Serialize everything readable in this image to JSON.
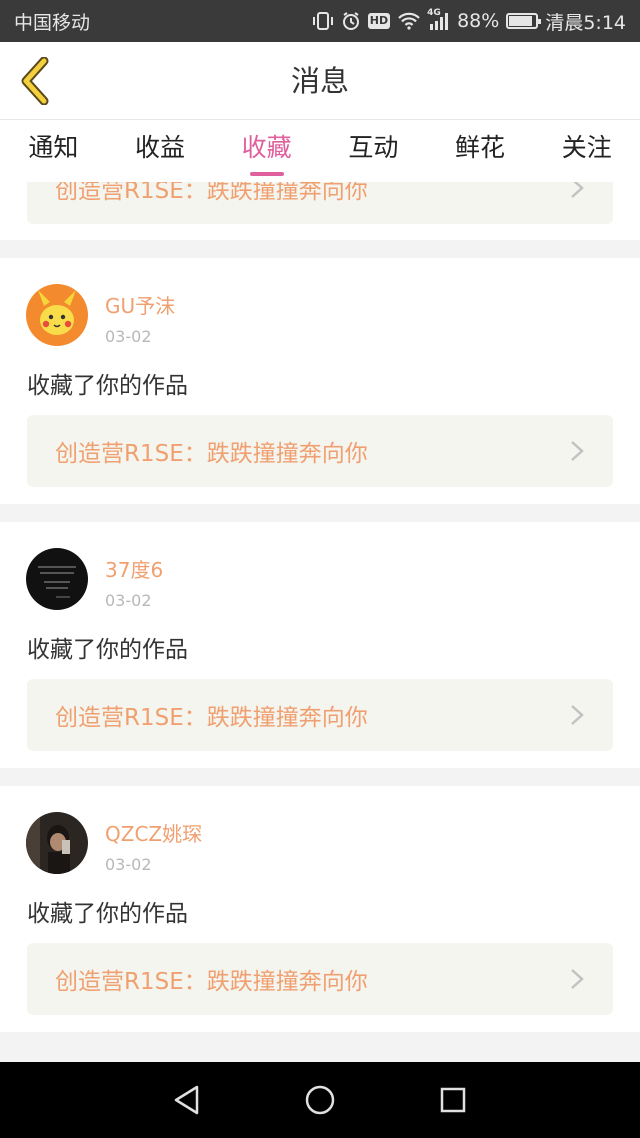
{
  "status_bar": {
    "carrier": "中国移动",
    "network": "4G",
    "battery": "88%",
    "battery_level": 0.88,
    "time": "清晨5:14",
    "hd_badge": "HD"
  },
  "header": {
    "title": "消息"
  },
  "tabs": [
    {
      "label": "通知",
      "active": false
    },
    {
      "label": "收益",
      "active": false
    },
    {
      "label": "收藏",
      "active": true
    },
    {
      "label": "互动",
      "active": false
    },
    {
      "label": "鲜花",
      "active": false
    },
    {
      "label": "关注",
      "active": false
    }
  ],
  "items": [
    {
      "work_title": "创造营R1SE：跌跌撞撞奔向你"
    },
    {
      "username": "GU予沫",
      "date": "03-02",
      "action": "收藏了你的作品",
      "work_title": "创造营R1SE：跌跌撞撞奔向你"
    },
    {
      "username": "37度6",
      "date": "03-02",
      "action": "收藏了你的作品",
      "work_title": "创造营R1SE：跌跌撞撞奔向你"
    },
    {
      "username": "QZCZ姚琛",
      "date": "03-02",
      "action": "收藏了你的作品",
      "work_title": "创造营R1SE：跌跌撞撞奔向你"
    }
  ],
  "colors": {
    "accent": "#e0609d",
    "username": "#f0a070",
    "back_arrow": "#f4d03f"
  }
}
